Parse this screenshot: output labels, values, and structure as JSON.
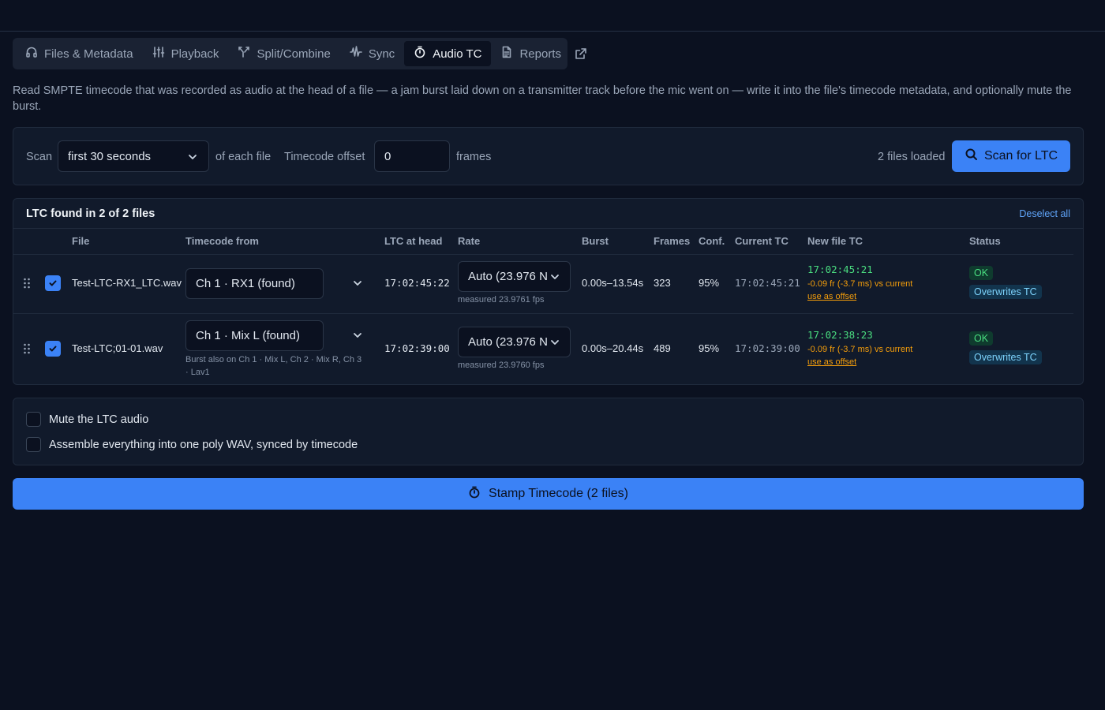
{
  "tabs": [
    {
      "label": "Files & Metadata",
      "icon": "headphones-icon",
      "active": false
    },
    {
      "label": "Playback",
      "icon": "sliders-icon",
      "active": false
    },
    {
      "label": "Split/Combine",
      "icon": "split-icon",
      "active": false
    },
    {
      "label": "Sync",
      "icon": "waveform-icon",
      "active": false
    },
    {
      "label": "Audio TC",
      "icon": "stopwatch-icon",
      "active": true
    },
    {
      "label": "Reports",
      "icon": "document-icon",
      "active": false
    }
  ],
  "description": "Read SMPTE timecode that was recorded as audio at the head of a file — a jam burst laid down on a transmitter track before the mic went on — write it into the file's timecode metadata, and optionally mute the burst.",
  "scan": {
    "scan_label": "Scan",
    "range_value": "first 30 seconds",
    "each_file_label": "of each file",
    "offset_label": "Timecode offset",
    "offset_value": "0",
    "frames_label": "frames",
    "files_loaded": "2 files loaded",
    "scan_button": "Scan for LTC"
  },
  "results": {
    "title": "LTC found in 2 of 2 files",
    "deselect_all": "Deselect all",
    "headers": {
      "file": "File",
      "timecode_from": "Timecode from",
      "ltc_at_head": "LTC at head",
      "rate": "Rate",
      "burst": "Burst",
      "frames": "Frames",
      "conf": "Conf.",
      "current_tc": "Current TC",
      "new_file_tc": "New file TC",
      "status": "Status"
    },
    "rows": [
      {
        "checked": true,
        "file": "Test-LTC-RX1_LTC.wav",
        "timecode_from": "Ch 1 · RX1 (found)",
        "timecode_note": "",
        "ltc_at_head": "17:02:45:22",
        "rate": "Auto (23.976 N",
        "measured": "measured 23.9761 fps",
        "burst": "0.00s–13.54s",
        "frames": "323",
        "conf": "95%",
        "current_tc": "17:02:45:21",
        "new_tc": "17:02:45:21",
        "delta": "-0.09 fr (-3.7 ms) vs current",
        "use_offset": "use as offset",
        "status_ok": "OK",
        "status_note": "Overwrites TC"
      },
      {
        "checked": true,
        "file": "Test-LTC;01-01.wav",
        "timecode_from": "Ch 1 · Mix L (found)",
        "timecode_note": "Burst also on Ch 1 · Mix L, Ch 2 · Mix R, Ch 3 · Lav1",
        "ltc_at_head": "17:02:39:00",
        "rate": "Auto (23.976 N",
        "measured": "measured 23.9760 fps",
        "burst": "0.00s–20.44s",
        "frames": "489",
        "conf": "95%",
        "current_tc": "17:02:39:00",
        "new_tc": "17:02:38:23",
        "delta": "-0.09 fr (-3.7 ms) vs current",
        "use_offset": "use as offset",
        "status_ok": "OK",
        "status_note": "Overwrites TC"
      }
    ]
  },
  "options": {
    "mute": {
      "label": "Mute the LTC audio",
      "checked": false
    },
    "assemble": {
      "label": "Assemble everything into one poly WAV, synced by timecode",
      "checked": false
    }
  },
  "stamp_button": "Stamp Timecode (2 files)",
  "colors": {
    "accent": "#3b82f6",
    "background": "#0b1120",
    "panel": "#111a2b",
    "ok_green": "#4ade80",
    "warning_amber": "#f59e0b"
  }
}
